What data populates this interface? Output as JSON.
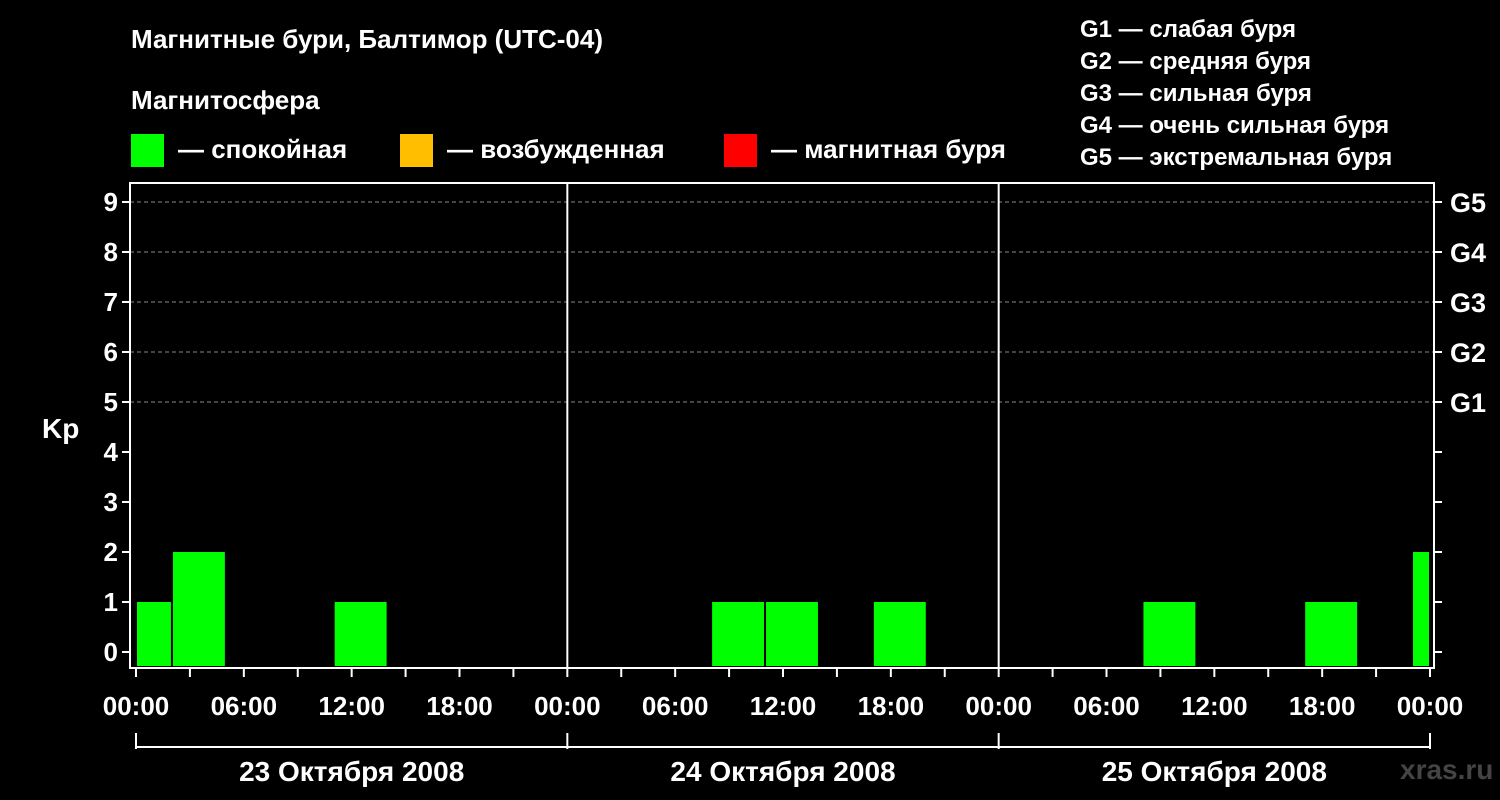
{
  "header": {
    "title": "Магнитные бури, Балтимор (UTC-04)",
    "subtitle": "Магнитосфера"
  },
  "legend": [
    {
      "text": "— спокойная",
      "color": "#00ff00"
    },
    {
      "text": "— возбужденная",
      "color": "#ffbf00"
    },
    {
      "text": "— магнитная буря",
      "color": "#ff0000"
    }
  ],
  "g_legend": [
    "G1 — слабая буря",
    "G2 — средняя буря",
    "G3 — сильная буря",
    "G4 — очень сильная буря",
    "G5 — экстремальная буря"
  ],
  "watermark": "xras.ru",
  "chart_data": {
    "type": "bar",
    "ylabel": "Kp",
    "ylim": [
      0,
      9
    ],
    "y_ticks": [
      "0",
      "1",
      "2",
      "3",
      "4",
      "5",
      "6",
      "7",
      "8",
      "9"
    ],
    "right_ticks": [
      {
        "kp": 5,
        "label": "G1"
      },
      {
        "kp": 6,
        "label": "G2"
      },
      {
        "kp": 7,
        "label": "G3"
      },
      {
        "kp": 8,
        "label": "G4"
      },
      {
        "kp": 9,
        "label": "G5"
      }
    ],
    "x_hours_range": [
      0,
      72
    ],
    "x_tick_labels": [
      "00:00",
      "06:00",
      "12:00",
      "18:00",
      "00:00",
      "06:00",
      "12:00",
      "18:00",
      "00:00",
      "06:00",
      "12:00",
      "18:00",
      "00:00"
    ],
    "dates": [
      "23 Октября 2008",
      "24 Октября 2008",
      "25 Октября 2008"
    ],
    "grid": "dashed at Kp 5-9",
    "bars": [
      {
        "start": 0,
        "end": 2,
        "kp": 1,
        "color": "#00ff00"
      },
      {
        "start": 2,
        "end": 5,
        "kp": 2,
        "color": "#00ff00"
      },
      {
        "start": 11,
        "end": 14,
        "kp": 1,
        "color": "#00ff00"
      },
      {
        "start": 32,
        "end": 35,
        "kp": 1,
        "color": "#00ff00"
      },
      {
        "start": 35,
        "end": 38,
        "kp": 1,
        "color": "#00ff00"
      },
      {
        "start": 41,
        "end": 44,
        "kp": 1,
        "color": "#00ff00"
      },
      {
        "start": 56,
        "end": 59,
        "kp": 1,
        "color": "#00ff00"
      },
      {
        "start": 65,
        "end": 68,
        "kp": 1,
        "color": "#00ff00"
      },
      {
        "start": 71,
        "end": 72,
        "kp": 2,
        "color": "#00ff00"
      }
    ]
  }
}
